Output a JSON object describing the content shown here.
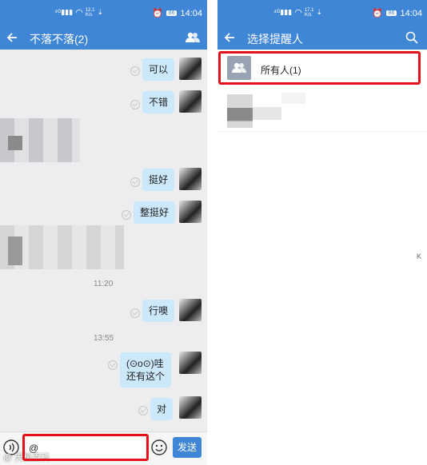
{
  "left": {
    "status": {
      "network": "12.1\nK/s",
      "battery": "86",
      "time": "14:04"
    },
    "header": {
      "title": "不落不落(2)"
    },
    "messages": [
      {
        "text": "可以"
      },
      {
        "text": "不错"
      },
      {
        "text": "挺好"
      },
      {
        "text": "整挺好"
      },
      {
        "text": "行噢"
      },
      {
        "text": "(⊙o⊙)哇\n还有这个"
      },
      {
        "text": "对"
      }
    ],
    "times": [
      "11:20",
      "13:55"
    ],
    "input": {
      "value": "@",
      "send_label": "发送"
    },
    "watermark": "@ 天极百科"
  },
  "right": {
    "status": {
      "network": "17.1\nK/s",
      "battery": "86",
      "time": "14:04"
    },
    "header": {
      "title": "选择提醒人"
    },
    "list": [
      {
        "label": "所有人(1)"
      }
    ],
    "side_index": "K"
  },
  "colors": {
    "accent": "#3f86d6",
    "highlight": "#e3121a",
    "bubble": "#cce8fb"
  }
}
